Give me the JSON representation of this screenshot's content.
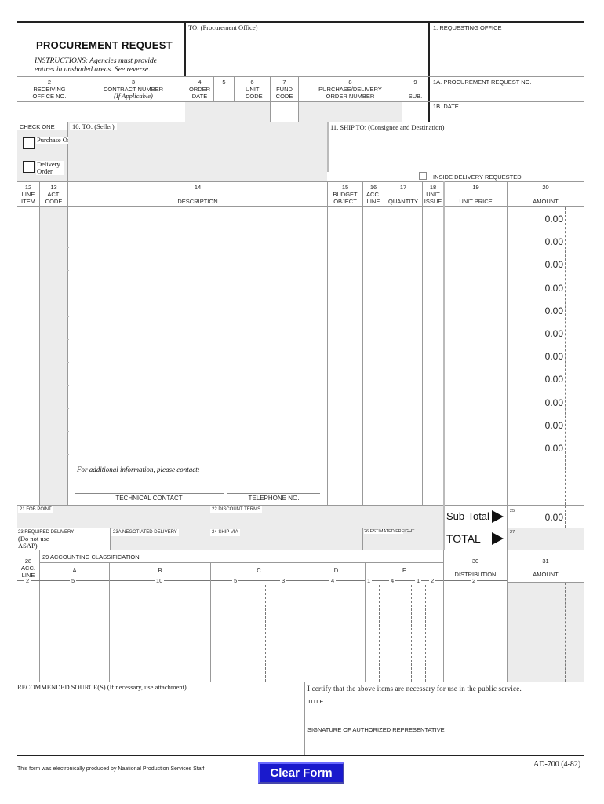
{
  "header": {
    "title": "PROCUREMENT REQUEST",
    "instructions": "INSTRUCTIONS:  Agencies must provide entires in unshaded areas. See reverse.",
    "to_label": "TO:  (Procurement Office)",
    "requesting_office": "1. REQUESTING OFFICE",
    "request_no": "1A. PROCUREMENT REQUEST NO.",
    "date": "1B. DATE"
  },
  "fields_row": [
    {
      "num": "2",
      "label": "RECEIVING OFFICE NO."
    },
    {
      "num": "3",
      "label": "CONTRACT NUMBER",
      "sub": "(If Applicable)"
    },
    {
      "num": "4",
      "label": "ORDER DATE"
    },
    {
      "num": "5",
      "label": ""
    },
    {
      "num": "6",
      "label": "UNIT CODE"
    },
    {
      "num": "7",
      "label": "FUND CODE"
    },
    {
      "num": "8",
      "label": "PURCHASE/DELIVERY ORDER NUMBER"
    },
    {
      "num": "9",
      "label": "SUB."
    }
  ],
  "check": {
    "title": "CHECK ONE",
    "options": [
      {
        "label": "Purchase Order",
        "checked": false
      },
      {
        "label": "Delivery Order",
        "checked": false
      }
    ],
    "seller": "10. TO:  (Seller)",
    "ship_to": "11. SHIP TO:  (Consignee and Destination)",
    "inside_delivery": "INSIDE DELIVERY REQUESTED"
  },
  "items_table": {
    "columns": [
      {
        "num": "12",
        "label": "LINE ITEM"
      },
      {
        "num": "13",
        "label": "ACT. CODE"
      },
      {
        "num": "14",
        "label": "DESCRIPTION"
      },
      {
        "num": "15",
        "label": "BUDGET OBJECT"
      },
      {
        "num": "16",
        "label": "ACC. LINE"
      },
      {
        "num": "17",
        "label": "QUANTITY"
      },
      {
        "num": "18",
        "label": "UNIT ISSUE"
      },
      {
        "num": "19",
        "label": "UNIT PRICE"
      },
      {
        "num": "20",
        "label": "AMOUNT"
      }
    ],
    "amounts": [
      "0.00",
      "0.00",
      "0.00",
      "0.00",
      "0.00",
      "0.00",
      "0.00",
      "0.00",
      "0.00",
      "0.00",
      "0.00"
    ],
    "contact_note": "For additional information, please contact:",
    "technical_contact": "TECHNICAL CONTACT",
    "telephone": "TELEPHONE NO."
  },
  "terms": {
    "fob": "21  FOB POINT",
    "discount": "22  DISCOUNT TERMS",
    "subtotal_label": "Sub-Total",
    "subtotal_num": "25",
    "subtotal_value": "0.00",
    "required_delivery": "23  REQUIRED DELIVERY",
    "required_note": "(Do not use ASAP)",
    "negotiated": "23A  NEGOTIATED DELIVERY",
    "ship_via": "24  SHIP VIA",
    "freight": "26  ESTIMATED FREIGHT",
    "total_label": "TOTAL",
    "total_num": "27"
  },
  "accounting": {
    "acc_line_num": "28",
    "acc_line_label": "ACC. LINE",
    "acc_line_width": "2",
    "title": "29  ACCOUNTING CLASSIFICATION",
    "columns": [
      {
        "label": "A",
        "widths": [
          "5"
        ]
      },
      {
        "label": "B",
        "widths": [
          "10"
        ]
      },
      {
        "label": "C",
        "widths": [
          "5",
          "3"
        ]
      },
      {
        "label": "D",
        "widths": [
          "4"
        ]
      },
      {
        "label": "E",
        "widths": [
          "1",
          "4",
          "1",
          "2"
        ]
      }
    ],
    "distribution_num": "30",
    "distribution": "DISTRIBUTION",
    "distribution_width": "2",
    "amount_num": "31",
    "amount": "AMOUNT"
  },
  "footer": {
    "recommended": "RECOMMENDED SOURCE(S) (If necessary, use attachment)",
    "certify": "I certify that the above items are necessary for use in the public service.",
    "title": "TITLE",
    "signature": "SIGNATURE OF AUTHORIZED REPRESENTATIVE",
    "produced_by": "This form was electronically produced by Naational Production Services Staff",
    "clear_button": "Clear Form",
    "form_id": "AD-700 (4-82)"
  },
  "colors": {
    "shade": "#ececec",
    "button_bg": "#1a1acc",
    "button_text": "#ffffff"
  }
}
